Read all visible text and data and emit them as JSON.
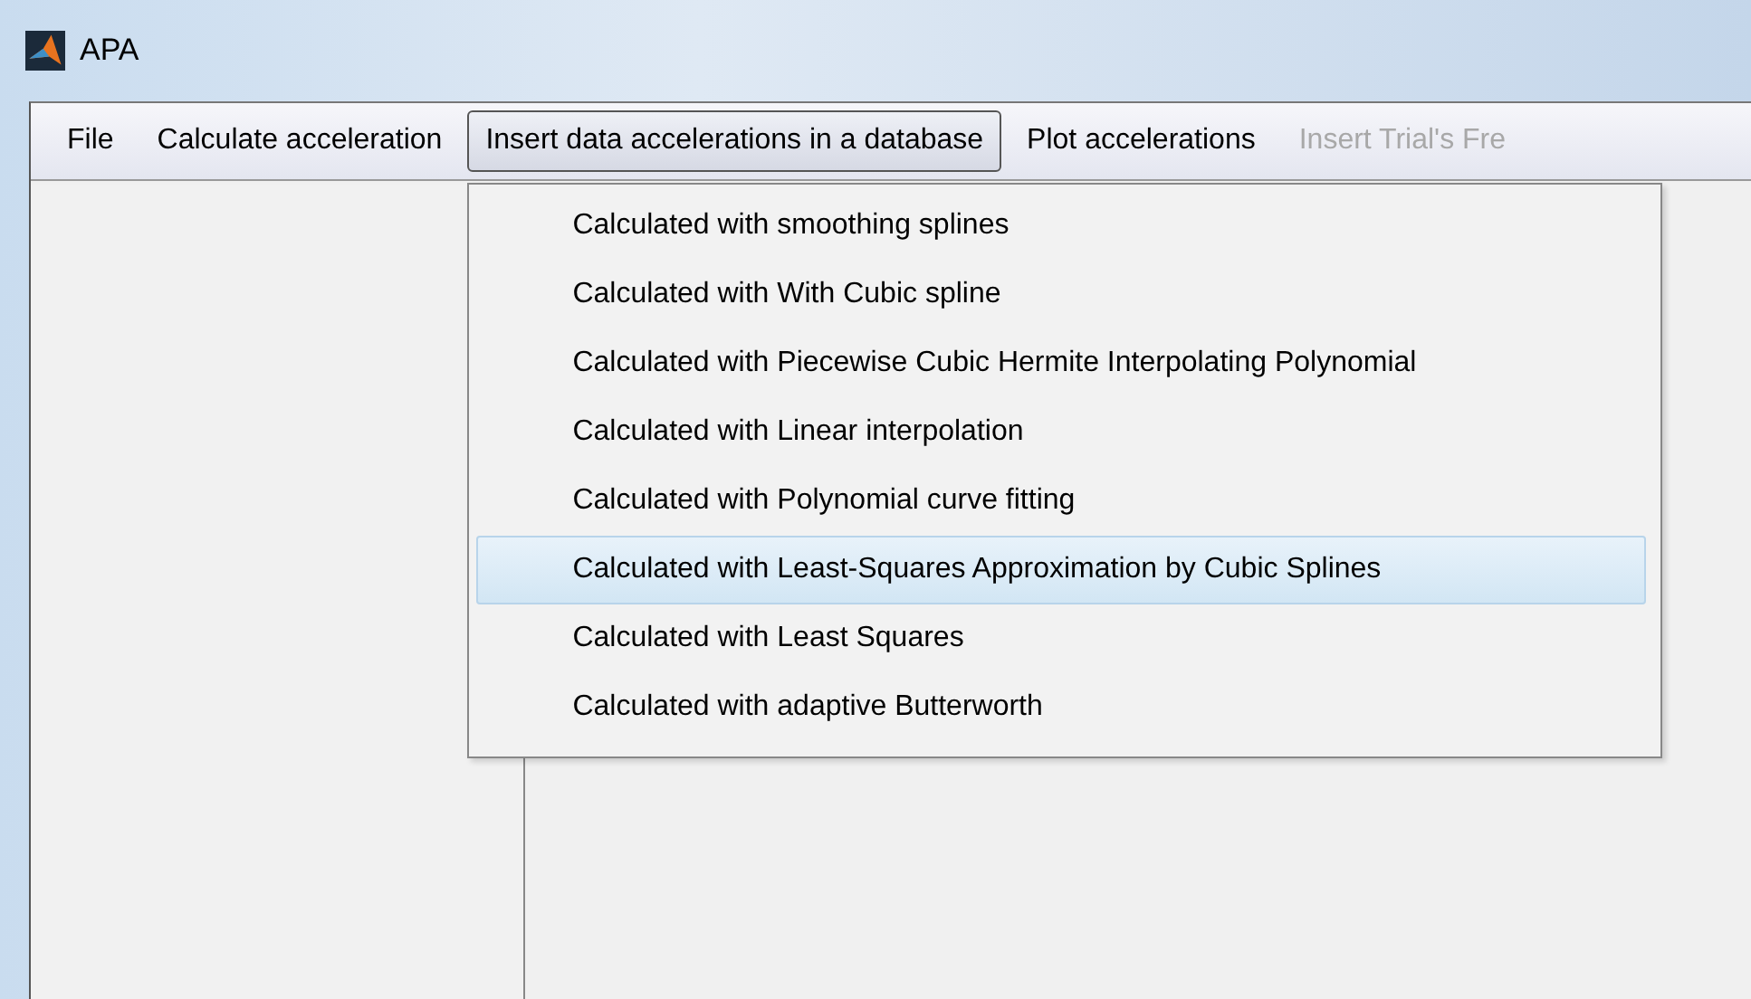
{
  "window": {
    "title": "APA"
  },
  "menu_bar": [
    {
      "label": "File",
      "selected": false,
      "disabled": false
    },
    {
      "label": "Calculate acceleration",
      "selected": false,
      "disabled": false
    },
    {
      "label": "Insert data accelerations in a database",
      "selected": true,
      "disabled": false
    },
    {
      "label": "Plot accelerations",
      "selected": false,
      "disabled": false
    },
    {
      "label": "Insert Trial's Fre",
      "selected": false,
      "disabled": true
    }
  ],
  "dropdown": [
    {
      "label": "Calculated with smoothing splines",
      "selected": false
    },
    {
      "label": "Calculated with With Cubic spline",
      "selected": false
    },
    {
      "label": "Calculated with Piecewise Cubic Hermite Interpolating Polynomial",
      "selected": false
    },
    {
      "label": "Calculated with Linear interpolation",
      "selected": false
    },
    {
      "label": "Calculated with Polynomial curve fitting",
      "selected": false
    },
    {
      "label": "Calculated with Least-Squares Approximation by Cubic Splines",
      "selected": true
    },
    {
      "label": "Calculated with Least Squares",
      "selected": false
    },
    {
      "label": "Calculated with adaptive Butterworth",
      "selected": false
    }
  ]
}
